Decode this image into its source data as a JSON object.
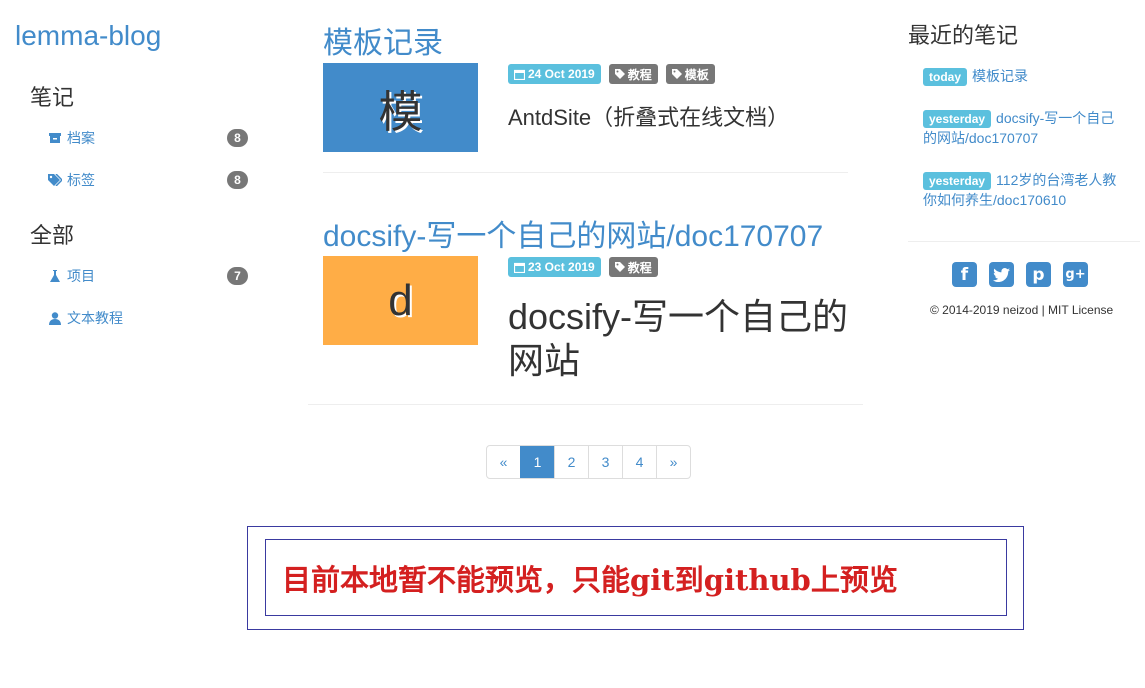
{
  "brand": "lemma-blog",
  "nav": {
    "notes_heading": "笔记",
    "archive": {
      "label": "档案",
      "count": "8"
    },
    "tags": {
      "label": "标签",
      "count": "8"
    },
    "all_heading": "全部",
    "projects": {
      "label": "项目",
      "count": "7"
    },
    "tutorials": {
      "label": "文本教程"
    }
  },
  "posts": [
    {
      "title": "模板记录",
      "thumb_text": "模",
      "thumb_color": "#428bca",
      "date": "24 Oct 2019",
      "tags": [
        "教程",
        "模板"
      ],
      "excerpt": "AntdSite（折叠式在线文档）"
    },
    {
      "title": "docsify-写一个自己的网站/doc170707",
      "thumb_text": "d",
      "thumb_color": "#ffad46",
      "date": "23 Oct 2019",
      "tags": [
        "教程"
      ],
      "excerpt_line1": "docsify-写一个自己的",
      "excerpt_line2": "网站"
    }
  ],
  "pagination": [
    "«",
    "1",
    "2",
    "3",
    "4",
    "»"
  ],
  "sidebar": {
    "heading": "最近的笔记",
    "recent": [
      {
        "badge": "today",
        "text": "模板记录"
      },
      {
        "badge": "yesterday",
        "text": "docsify-写一个自己的网站/doc170707"
      },
      {
        "badge": "yesterday",
        "text": "112岁的台湾老人教你如何养生/doc170610"
      }
    ],
    "social_icons": [
      "facebook-icon",
      "twitter-icon",
      "pinterest-icon",
      "google-plus-icon"
    ],
    "copyright": "© 2014-2019 neizod | MIT License"
  },
  "notice": "目前本地暂不能预览，只能git到github上预览",
  "colors": {
    "accent": "#428bca",
    "badge_info": "#5bc0de",
    "badge_default": "#777777",
    "notice_text": "#d42020"
  }
}
